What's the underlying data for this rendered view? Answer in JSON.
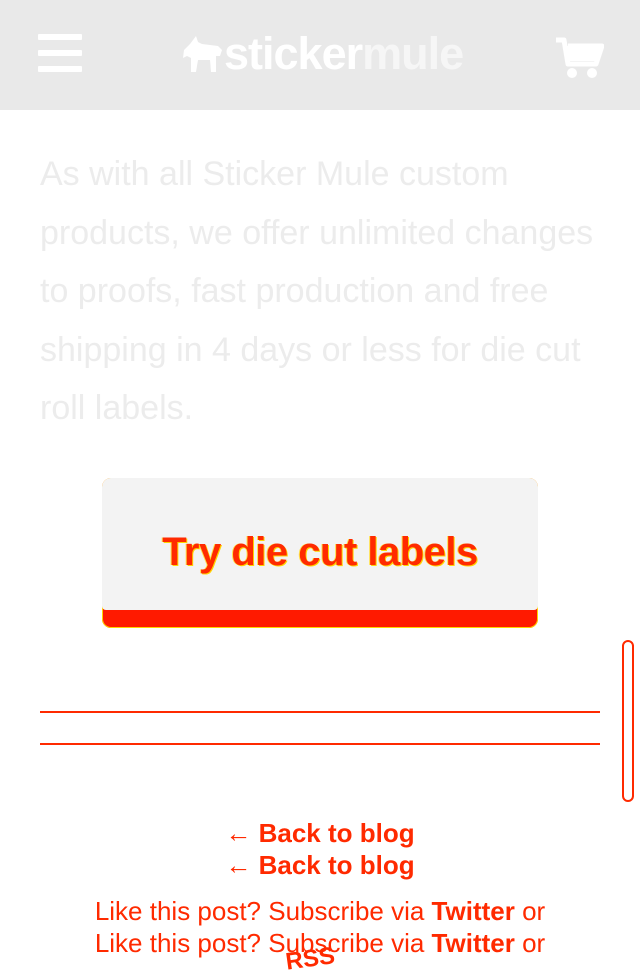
{
  "header": {
    "menu_icon": "hamburger-menu-icon",
    "logo": {
      "word1": "sticker",
      "word2": "mule",
      "icon": "mule-icon"
    },
    "cart_icon": "shopping-cart-icon",
    "background": "#e9e9e9"
  },
  "content": {
    "paragraph": "As with all Sticker Mule custom products, we offer unlimited changes to proofs, fast production and free shipping in 4 days or less for die cut roll labels.",
    "cta_label": "Try die cut labels"
  },
  "footer": {
    "back_link_1": "← Back to blog",
    "back_link_2": "← Back to blog",
    "subscribe_prefix": "Like this post? Subscribe via ",
    "subscribe_twitter": "Twitter",
    "subscribe_or": " or",
    "rss": "RSS"
  },
  "colors": {
    "accent": "#ff2a00",
    "highlight": "#ffd400",
    "faded_text": "#ececec"
  }
}
